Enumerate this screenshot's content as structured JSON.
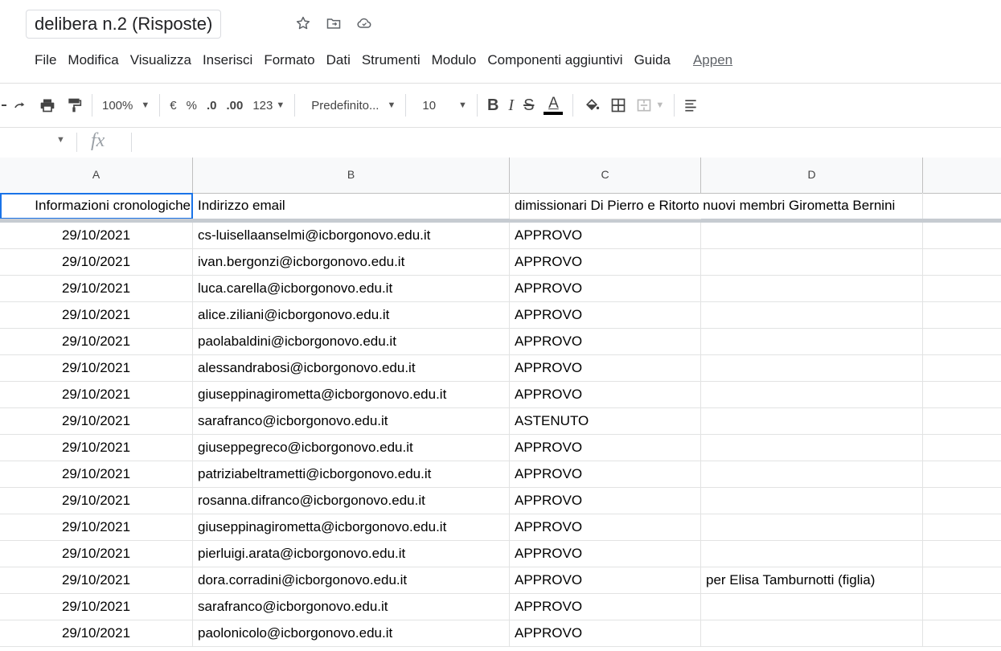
{
  "title": "delibera n.2 (Risposte)",
  "title_icons": [
    "star-icon",
    "move-to-folder-icon",
    "cloud-status-icon"
  ],
  "menu": [
    "File",
    "Modifica",
    "Visualizza",
    "Inserisci",
    "Formato",
    "Dati",
    "Strumenti",
    "Modulo",
    "Componenti aggiuntivi",
    "Guida"
  ],
  "menu_link": "Appen",
  "toolbar": {
    "zoom": "100%",
    "currency": "€",
    "percent": "%",
    "decrease_decimals": ".0",
    "increase_decimals": ".00",
    "more_formats": "123",
    "font": "Predefinito...",
    "font_size": "10",
    "bold": "B",
    "italic": "I",
    "strike": "S",
    "text_color_label": "A",
    "text_color": "#000000"
  },
  "formula": {
    "fx": "fx",
    "value": ""
  },
  "columns": [
    "A",
    "B",
    "C",
    "D"
  ],
  "header": {
    "a": "Informazioni cronologiche",
    "b": "Indirizzo email",
    "c": "dimissionari Di Pierro e Ritorto nuovi membri Girometta Bernini",
    "d": ""
  },
  "rows": [
    {
      "date": "29/10/2021",
      "email": "cs-luisellaanselmi@icborgonovo.edu.it",
      "vote": "APPROVO",
      "note": ""
    },
    {
      "date": "29/10/2021",
      "email": "ivan.bergonzi@icborgonovo.edu.it",
      "vote": "APPROVO",
      "note": ""
    },
    {
      "date": "29/10/2021",
      "email": "luca.carella@icborgonovo.edu.it",
      "vote": "APPROVO",
      "note": ""
    },
    {
      "date": "29/10/2021",
      "email": "alice.ziliani@icborgonovo.edu.it",
      "vote": "APPROVO",
      "note": ""
    },
    {
      "date": "29/10/2021",
      "email": "paolabaldini@icborgonovo.edu.it",
      "vote": "APPROVO",
      "note": ""
    },
    {
      "date": "29/10/2021",
      "email": "alessandrabosi@icborgonovo.edu.it",
      "vote": "APPROVO",
      "note": ""
    },
    {
      "date": "29/10/2021",
      "email": "giuseppinagirometta@icborgonovo.edu.it",
      "vote": "APPROVO",
      "note": ""
    },
    {
      "date": "29/10/2021",
      "email": "sarafranco@icborgonovo.edu.it",
      "vote": "ASTENUTO",
      "note": ""
    },
    {
      "date": "29/10/2021",
      "email": "giuseppegreco@icborgonovo.edu.it",
      "vote": "APPROVO",
      "note": ""
    },
    {
      "date": "29/10/2021",
      "email": "patriziabeltrametti@icborgonovo.edu.it",
      "vote": "APPROVO",
      "note": ""
    },
    {
      "date": "29/10/2021",
      "email": "rosanna.difranco@icborgonovo.edu.it",
      "vote": "APPROVO",
      "note": ""
    },
    {
      "date": "29/10/2021",
      "email": "giuseppinagirometta@icborgonovo.edu.it",
      "vote": "APPROVO",
      "note": ""
    },
    {
      "date": "29/10/2021",
      "email": "pierluigi.arata@icborgonovo.edu.it",
      "vote": "APPROVO",
      "note": ""
    },
    {
      "date": "29/10/2021",
      "email": "dora.corradini@icborgonovo.edu.it",
      "vote": "APPROVO",
      "note": "per Elisa Tamburnotti (figlia)"
    },
    {
      "date": "29/10/2021",
      "email": "sarafranco@icborgonovo.edu.it",
      "vote": "APPROVO",
      "note": ""
    },
    {
      "date": "29/10/2021",
      "email": "paolonicolo@icborgonovo.edu.it",
      "vote": "APPROVO",
      "note": ""
    }
  ]
}
